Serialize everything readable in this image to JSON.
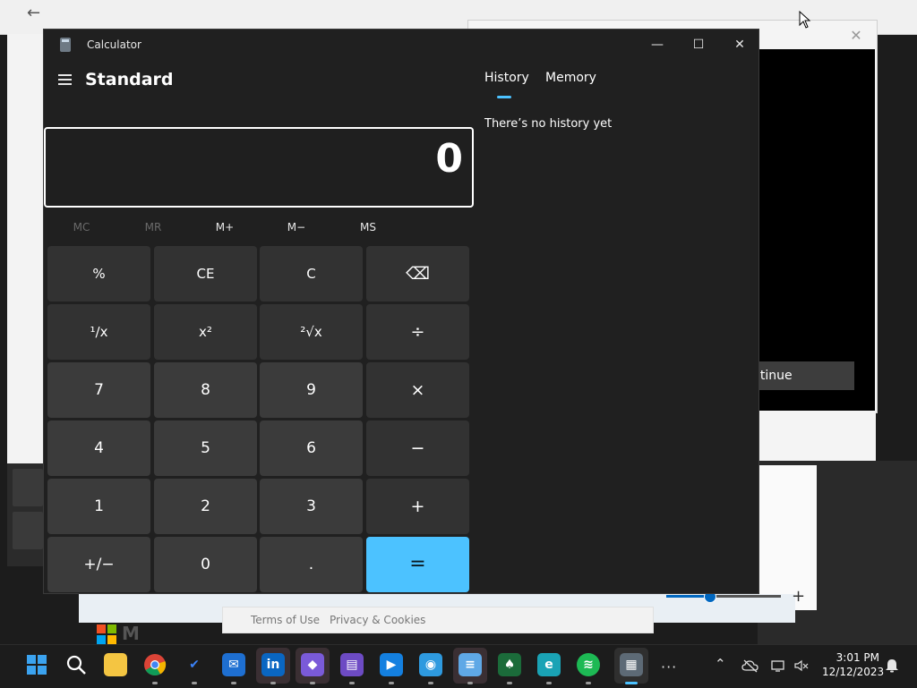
{
  "background": {
    "dialog_continue_label": "ntinue",
    "footer_terms": "Terms of Use",
    "footer_privacy": "Privacy & Cookies",
    "brand_text": "M",
    "back_icon": "arrow-left-icon",
    "close_icon": "close-icon",
    "slider_plus": "+"
  },
  "calculator": {
    "app_title": "Calculator",
    "window_controls": {
      "minimize": "—",
      "maximize": "☐",
      "close": "✕"
    },
    "mode": "Standard",
    "display_value": "0",
    "memory": [
      {
        "label": "MC",
        "enabled": false
      },
      {
        "label": "MR",
        "enabled": false
      },
      {
        "label": "M+",
        "enabled": true
      },
      {
        "label": "M−",
        "enabled": true
      },
      {
        "label": "MS",
        "enabled": true
      }
    ],
    "keys": [
      [
        "%",
        "CE",
        "C",
        "⌫"
      ],
      [
        "¹∕x",
        "x²",
        "²√x",
        "÷"
      ],
      [
        "7",
        "8",
        "9",
        "×"
      ],
      [
        "4",
        "5",
        "6",
        "−"
      ],
      [
        "1",
        "2",
        "3",
        "+"
      ],
      [
        "+/−",
        "0",
        ".",
        "="
      ]
    ],
    "panel_tabs": [
      {
        "label": "History",
        "active": true
      },
      {
        "label": "Memory",
        "active": false
      }
    ],
    "history_empty": "There’s no history yet",
    "accent_color": "#4cc2ff"
  },
  "taskbar": {
    "apps": [
      "start",
      "search",
      "file-explorer",
      "chrome",
      "todo",
      "mail",
      "linkedin",
      "clipchamp-like",
      "video-editor",
      "media-player",
      "maps",
      "notepad",
      "solitaire",
      "edge",
      "spotify",
      "calculator"
    ],
    "overflow": "···",
    "time": "3:01 PM",
    "date": "12/12/2023"
  }
}
